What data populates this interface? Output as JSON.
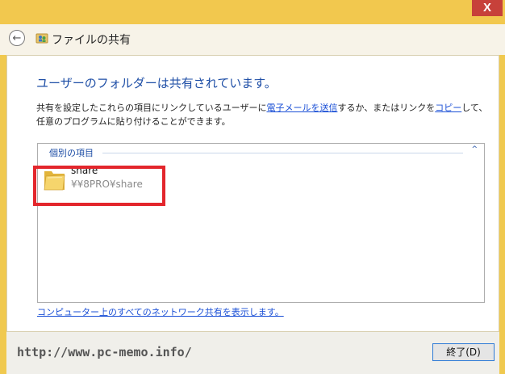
{
  "window": {
    "title": "ファイルの共有",
    "close_glyph": "X"
  },
  "nav": {
    "back_glyph": "←"
  },
  "main": {
    "heading": "ユーザーのフォルダーは共有されています。",
    "description": {
      "part1": "共有を設定したこれらの項目にリンクしているユーザーに",
      "email_link": "電子メールを送信",
      "part2": "するか、またはリンクを",
      "copy_link": "コピー",
      "part3": "して、任意のプログラムに貼り付けることができます。"
    },
    "group": {
      "label": "個別の項目",
      "collapse_glyph": "^"
    },
    "items": [
      {
        "name": "share",
        "path": "¥¥8PRO¥share"
      }
    ],
    "network_link": "コンピューター上のすべてのネットワーク共有を表示します。"
  },
  "footer": {
    "watermark": "http://www.pc-memo.info/",
    "close_button": "終了(D)"
  },
  "colors": {
    "title_bar": "#f2c84e",
    "close_button": "#c7413a",
    "heading": "#1e4ea6",
    "link": "#1a4fd6",
    "highlight": "#e3262c"
  }
}
